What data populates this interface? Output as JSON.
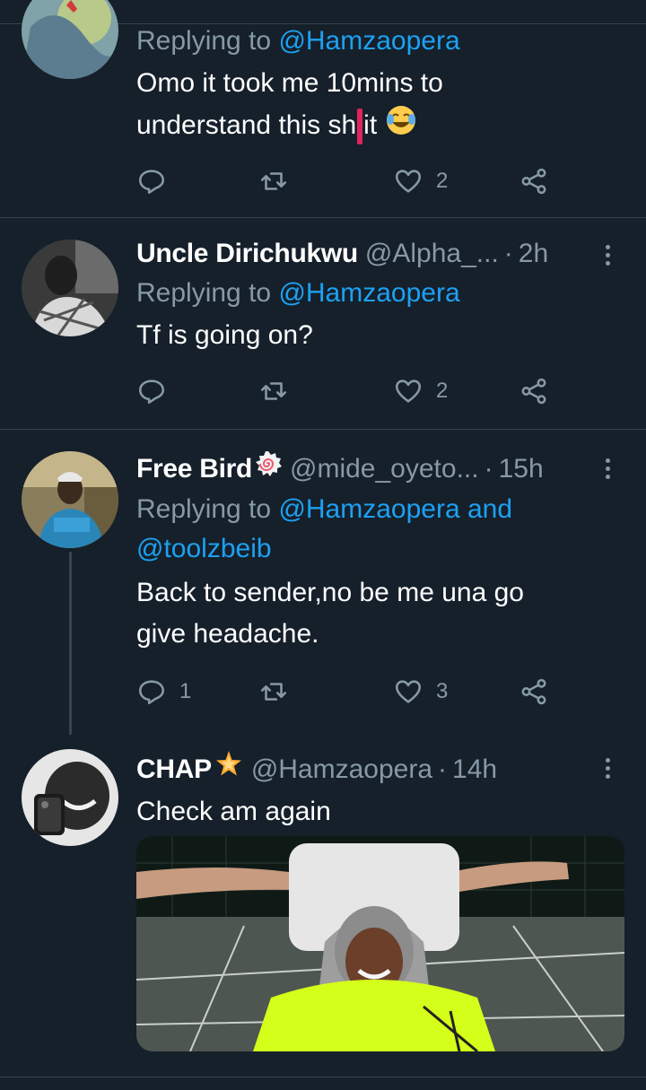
{
  "tweets": [
    {
      "reply_prefix": "Replying to ",
      "reply_to": "@Hamzaopera",
      "text_part1": "Omo it took me 10mins to",
      "text_part2a": "understand this sh",
      "text_part2b": "it",
      "emoji_icon": "face-with-tears-of-joy-icon",
      "reply_count": "",
      "retweet_count": "",
      "like_count": "2"
    },
    {
      "name": "Uncle Dirichukwu",
      "handle": "@Alpha_...",
      "dot": "·",
      "time": "2h",
      "reply_prefix": "Replying to ",
      "reply_to": "@Hamzaopera",
      "text": "Tf is going on?",
      "reply_count": "",
      "retweet_count": "",
      "like_count": "2"
    },
    {
      "name": "Free Bird",
      "name_emoji_icon": "fish-cake-swirl-icon",
      "handle": "@mide_oyeto...",
      "dot": "·",
      "time": "15h",
      "reply_prefix": "Replying to ",
      "reply_to": "@Hamzaopera and",
      "reply_to_2": "@toolzbeib",
      "text_line1": "Back to sender,no be me una go",
      "text_line2": "give headache.",
      "reply_count": "1",
      "retweet_count": "",
      "like_count": "3"
    },
    {
      "name": "CHAP",
      "name_emoji_icon": "glowing-star-icon",
      "handle": "@Hamzaopera",
      "dot": "·",
      "time": "14h",
      "text": "Check am again",
      "media": "photo-of-woman-in-neon-top-on-basketball-court"
    }
  ],
  "colors": {
    "background": "#15202b",
    "secondary_text": "#8899a6",
    "link": "#1da1f2",
    "divider": "#38444d"
  }
}
